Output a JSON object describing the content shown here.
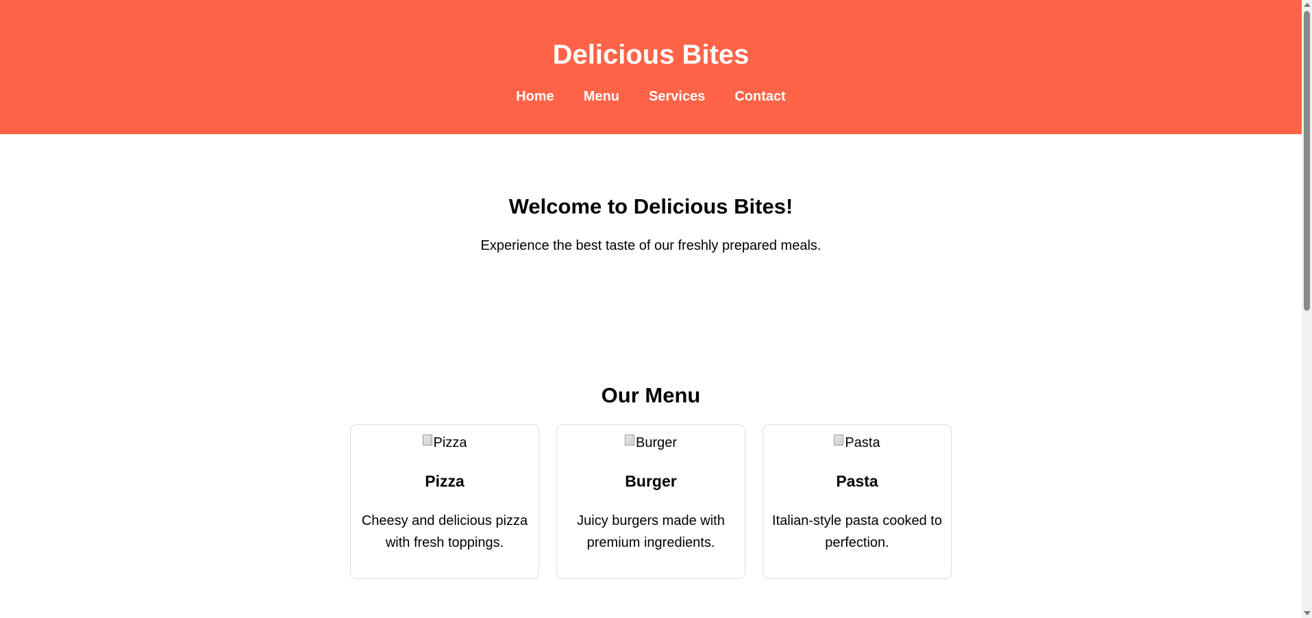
{
  "header": {
    "title": "Delicious Bites",
    "nav": [
      "Home",
      "Menu",
      "Services",
      "Contact"
    ],
    "accent_color": "#ff6347"
  },
  "hero": {
    "heading": "Welcome to Delicious Bites!",
    "text": "Experience the best taste of our freshly prepared meals."
  },
  "menu": {
    "heading": "Our Menu",
    "items": [
      {
        "img_alt": "Pizza",
        "name": "Pizza",
        "description": "Cheesy and delicious pizza with fresh toppings."
      },
      {
        "img_alt": "Burger",
        "name": "Burger",
        "description": "Juicy burgers made with premium ingredients."
      },
      {
        "img_alt": "Pasta",
        "name": "Pasta",
        "description": "Italian-style pasta cooked to perfection."
      }
    ]
  }
}
